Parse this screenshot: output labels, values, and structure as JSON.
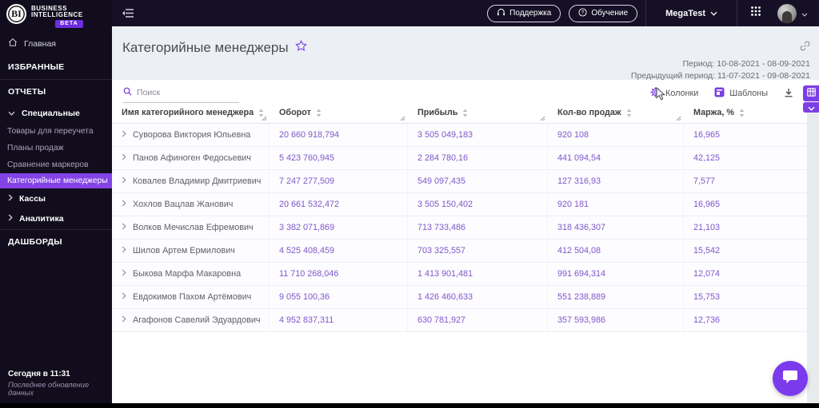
{
  "colors": {
    "accent": "#7b3fe4",
    "selected": "#8343e6",
    "number": "#7e57c9",
    "topbar": "#151026",
    "sidebar": "#110d1d",
    "badge": "#6d2ce0",
    "chat": "#7c3aed",
    "pagebg": "#eceff4",
    "panel": "#ffffff"
  },
  "icons": {
    "bi-logo": "BI monogram in white circle",
    "hamburger-icon": "three lines with left arrow",
    "headset-icon": "headphones glyph",
    "question-icon": "question mark in circle",
    "apps-grid-icon": "3x3 dots",
    "chevron-down-icon": "v chevron",
    "home-icon": "house outline",
    "star-icon": "purple outline star",
    "link-icon": "chain link",
    "search-icon": "purple magnifier",
    "gear-icon": "purple gear",
    "templates-icon": "purple rounded square",
    "download-icon": "down arrow with tray",
    "table-export-icon": "white grid in purple square",
    "sort-icon": "up/down triangles",
    "resize-handle-icon": "diagonal grip lines",
    "row-expand-icon": "right chevron",
    "chat-icon": "white speech bubble"
  },
  "brand": {
    "abbr": "BI",
    "name_line1": "BUSINESS",
    "name_line2": "INTELLIGENCE",
    "beta_label": "BETA"
  },
  "topbar": {
    "support_label": "Поддержка",
    "training_label": "Обучение",
    "workspace_label": "MegaTest"
  },
  "sidebar": {
    "home_label": "Главная",
    "favorites_label": "ИЗБРАННЫЕ",
    "reports_label": "ОТЧЕТЫ",
    "special_group_label": "Специальные",
    "special_items": [
      "Товары для переучета",
      "Планы продаж",
      "Сравнение маркеров",
      "Категорийные менеджеры"
    ],
    "cash_label": "Кассы",
    "analytics_label": "Аналитика",
    "dashboards_label": "ДАШБОРДЫ",
    "last_update_time": "Сегодня в 11:31",
    "last_update_label": "Последнее обновление данных"
  },
  "page": {
    "title": "Категорийные менеджеры",
    "period_label": "Период: 10-08-2021 - 08-09-2021",
    "previous_period_label": "Предыдущий период: 11-07-2021 - 09-08-2021"
  },
  "toolbar": {
    "search_placeholder": "Поиск",
    "columns_label": "Колонки",
    "templates_label": "Шаблоны"
  },
  "table": {
    "headers": [
      "Имя категорийного менеджера",
      "Оборот",
      "Прибыль",
      "Кол-во продаж",
      "Маржа, %"
    ],
    "rows": [
      {
        "name": "Суворова Виктория Юльевна",
        "turnover": "20 660 918,794",
        "profit": "3 505 049,183",
        "sales": "920 108",
        "margin": "16,965"
      },
      {
        "name": "Панов Афиноген Федосьевич",
        "turnover": "5 423 760,945",
        "profit": "2 284 780,16",
        "sales": "441 094,54",
        "margin": "42,125"
      },
      {
        "name": "Ковалев Владимир Дмитриевич",
        "turnover": "7 247 277,509",
        "profit": "549 097,435",
        "sales": "127 316,93",
        "margin": "7,577"
      },
      {
        "name": "Хохлов Вацлав Жанович",
        "turnover": "20 661 532,472",
        "profit": "3 505 150,402",
        "sales": "920 181",
        "margin": "16,965"
      },
      {
        "name": "Волков Мечислав Ефремович",
        "turnover": "3 382 071,869",
        "profit": "713 733,486",
        "sales": "318 436,307",
        "margin": "21,103"
      },
      {
        "name": "Шилов Артем Ермилович",
        "turnover": "4 525 408,459",
        "profit": "703 325,557",
        "sales": "412 504,08",
        "margin": "15,542"
      },
      {
        "name": "Быкова Марфа Макаровна",
        "turnover": "11 710 268,046",
        "profit": "1 413 901,481",
        "sales": "991 694,314",
        "margin": "12,074"
      },
      {
        "name": "Евдокимов Пахом Артёмович",
        "turnover": "9 055 100,36",
        "profit": "1 426 460,633",
        "sales": "551 238,889",
        "margin": "15,753"
      },
      {
        "name": "Агафонов Савелий Эдуардович",
        "turnover": "4 952 837,311",
        "profit": "630 781,927",
        "sales": "357 593,986",
        "margin": "12,736"
      }
    ]
  }
}
